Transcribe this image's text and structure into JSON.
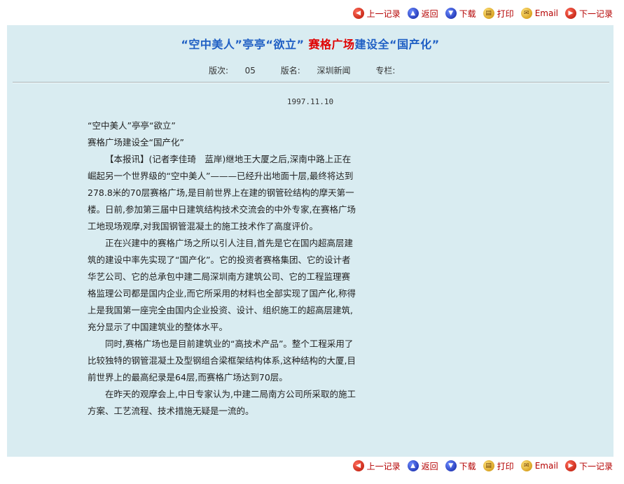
{
  "toolbar": {
    "items": [
      {
        "label": "上一记录",
        "icon": "prev-record-icon"
      },
      {
        "label": "返回",
        "icon": "back-icon"
      },
      {
        "label": "下载",
        "icon": "download-icon"
      },
      {
        "label": "打印",
        "icon": "print-icon"
      },
      {
        "label": "Email",
        "icon": "email-icon"
      },
      {
        "label": "下一记录",
        "icon": "next-record-icon"
      }
    ]
  },
  "article": {
    "title_part1": "“空中美人”亭亭“欲立” ",
    "title_highlight": "赛格广场",
    "title_part2": "建设全“国产化”",
    "meta": {
      "edition_label": "版次:",
      "edition_value": "05",
      "section_label": "版名:",
      "section_value": "深圳新闻",
      "column_label": "专栏:",
      "column_value": ""
    },
    "date": "1997.11.10",
    "headline1": "“空中美人”亭亭“欲立”",
    "headline2": "赛格广场建设全“国产化”",
    "paragraphs": [
      "【本报讯】(记者李佳琦　蓝岸)继地王大厦之后,深南中路上正在崛起另一个世界级的“空中美人”———已经升出地面十层,最终将达到278.8米的70层赛格广场,是目前世界上在建的钢管砼结构的摩天第一楼。日前,参加第三届中日建筑结构技术交流会的中外专家,在赛格广场工地现场观摩,对我国钢管混凝土的施工技术作了高度评价。",
      "正在兴建中的赛格广场之所以引人注目,首先是它在国内超高层建筑的建设中率先实现了“国产化”。它的投资者赛格集团、它的设计者华艺公司、它的总承包中建二局深圳南方建筑公司、它的工程监理赛格监理公司都是国内企业,而它所采用的材料也全部实现了国产化,称得上是我国第一座完全由国内企业投资、设计、组织施工的超高层建筑,充分显示了中国建筑业的整体水平。",
      "同时,赛格广场也是目前建筑业的“高技术产品”。整个工程采用了比较独特的钢管混凝土及型钢组合梁框架结构体系,这种结构的大厦,目前世界上的最高纪录是64层,而赛格广场达到70层。",
      "在昨天的观摩会上,中日专家认为,中建二局南方公司所采取的施工方案、工艺流程、技术措施无疑是一流的。"
    ]
  }
}
